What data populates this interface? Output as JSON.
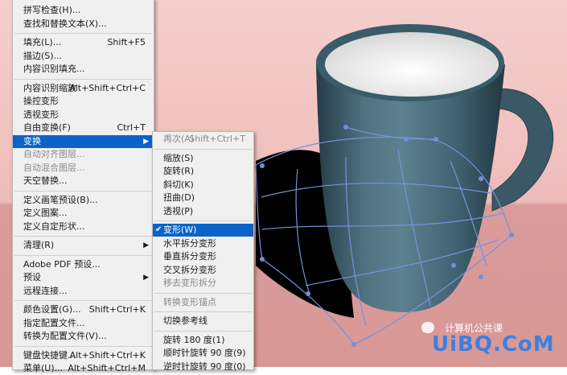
{
  "colors": {
    "menu_bg": "#f0f0f0",
    "highlight": "#0b63c8",
    "background_pink": "#f1c6c5",
    "mug": "#3b5a68",
    "warp_grid": "#6f8fd8",
    "watermark": "#3d7fe0"
  },
  "edit_menu": {
    "items": [
      {
        "label": "拼写检查(H)...",
        "shortcut": "",
        "state": "normal"
      },
      {
        "label": "查找和替换文本(X)...",
        "shortcut": "",
        "state": "normal"
      },
      {
        "separator": true
      },
      {
        "label": "填充(L)...",
        "shortcut": "Shift+F5",
        "state": "normal"
      },
      {
        "label": "描边(S)...",
        "shortcut": "",
        "state": "normal"
      },
      {
        "label": "内容识别填充...",
        "shortcut": "",
        "state": "normal"
      },
      {
        "separator": true
      },
      {
        "label": "内容识别缩放",
        "shortcut": "Alt+Shift+Ctrl+C",
        "state": "normal"
      },
      {
        "label": "操控变形",
        "shortcut": "",
        "state": "normal"
      },
      {
        "label": "透视变形",
        "shortcut": "",
        "state": "normal"
      },
      {
        "label": "自由变换(F)",
        "shortcut": "Ctrl+T",
        "state": "normal"
      },
      {
        "label": "变换",
        "shortcut": "",
        "state": "highlighted",
        "submenu": true
      },
      {
        "label": "自动对齐图层...",
        "shortcut": "",
        "state": "disabled"
      },
      {
        "label": "自动混合图层...",
        "shortcut": "",
        "state": "disabled"
      },
      {
        "label": "天空替换...",
        "shortcut": "",
        "state": "normal"
      },
      {
        "separator": true
      },
      {
        "label": "定义画笔预设(B)...",
        "shortcut": "",
        "state": "normal"
      },
      {
        "label": "定义图案...",
        "shortcut": "",
        "state": "normal"
      },
      {
        "label": "定义自定形状...",
        "shortcut": "",
        "state": "normal"
      },
      {
        "separator": true
      },
      {
        "label": "清理(R)",
        "shortcut": "",
        "state": "normal",
        "submenu": true
      },
      {
        "separator": true
      },
      {
        "label": "Adobe PDF 预设...",
        "shortcut": "",
        "state": "normal"
      },
      {
        "label": "预设",
        "shortcut": "",
        "state": "normal",
        "submenu": true
      },
      {
        "label": "远程连接...",
        "shortcut": "",
        "state": "normal"
      },
      {
        "separator": true
      },
      {
        "label": "颜色设置(G)...",
        "shortcut": "Shift+Ctrl+K",
        "state": "normal"
      },
      {
        "label": "指定配置文件...",
        "shortcut": "",
        "state": "normal"
      },
      {
        "label": "转换为配置文件(V)...",
        "shortcut": "",
        "state": "normal"
      },
      {
        "separator": true
      },
      {
        "label": "键盘快捷键...",
        "shortcut": "Alt+Shift+Ctrl+K",
        "state": "normal"
      },
      {
        "label": "菜单(U)...",
        "shortcut": "Alt+Shift+Ctrl+M",
        "state": "normal"
      }
    ]
  },
  "transform_submenu": {
    "items": [
      {
        "label": "再次(A)",
        "shortcut": "Shift+Ctrl+T",
        "state": "disabled"
      },
      {
        "separator": true
      },
      {
        "label": "缩放(S)",
        "shortcut": "",
        "state": "normal"
      },
      {
        "label": "旋转(R)",
        "shortcut": "",
        "state": "normal"
      },
      {
        "label": "斜切(K)",
        "shortcut": "",
        "state": "normal"
      },
      {
        "label": "扭曲(D)",
        "shortcut": "",
        "state": "normal"
      },
      {
        "label": "透视(P)",
        "shortcut": "",
        "state": "normal"
      },
      {
        "separator": true
      },
      {
        "label": "变形(W)",
        "shortcut": "",
        "state": "highlighted",
        "checked": true
      },
      {
        "label": "水平拆分变形",
        "shortcut": "",
        "state": "normal"
      },
      {
        "label": "垂直拆分变形",
        "shortcut": "",
        "state": "normal"
      },
      {
        "label": "交叉拆分变形",
        "shortcut": "",
        "state": "normal"
      },
      {
        "label": "移去变形拆分",
        "shortcut": "",
        "state": "disabled"
      },
      {
        "separator": true
      },
      {
        "label": "转换变形锚点",
        "shortcut": "",
        "state": "disabled"
      },
      {
        "separator": true
      },
      {
        "label": "切换参考线",
        "shortcut": "",
        "state": "normal"
      },
      {
        "separator": true
      },
      {
        "label": "旋转 180 度(1)",
        "shortcut": "",
        "state": "normal"
      },
      {
        "label": "顺时针旋转 90 度(9)",
        "shortcut": "",
        "state": "normal"
      },
      {
        "label": "逆时针旋转 90 度(0)",
        "shortcut": "",
        "state": "normal"
      }
    ]
  },
  "watermark": {
    "text": "UiBQ.CoM",
    "subtext": "计算机公共课",
    "icon": "wechat-icon"
  }
}
